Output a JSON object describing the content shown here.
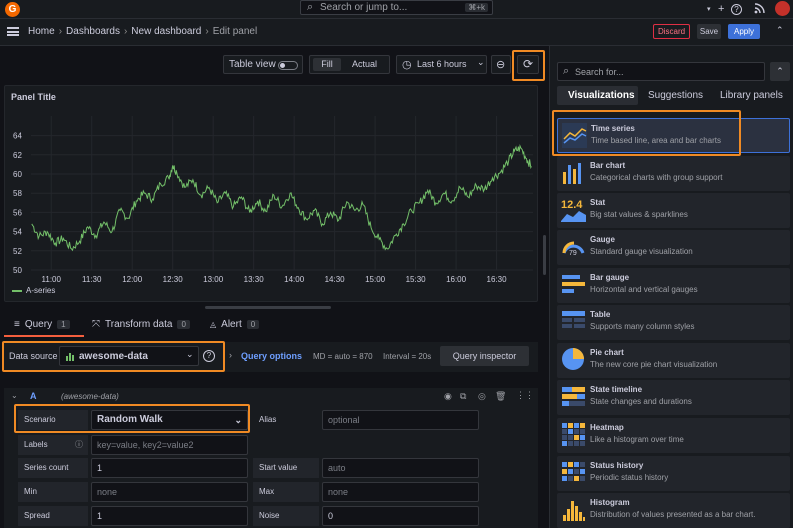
{
  "topbar": {
    "search_placeholder": "Search or jump to...",
    "search_shortcut": "⌘+k",
    "plus": "+",
    "plus_caret": "▾",
    "help": "?",
    "news": "☰",
    "logo": "G"
  },
  "breadcrumb": {
    "home": "Home",
    "dashboards": "Dashboards",
    "new_dashboard": "New dashboard",
    "current": "Edit panel",
    "separator": "›"
  },
  "actions": {
    "discard": "Discard",
    "save": "Save",
    "apply": "Apply",
    "collapse": "⌃"
  },
  "toolbar": {
    "table_view": "Table view",
    "fill": "Fill",
    "actual": "Actual",
    "time_range": "Last 6 hours",
    "time_caret": "⌄",
    "zoom_out": "⊖",
    "refresh": "⟳",
    "clock": "◷"
  },
  "panel": {
    "title": "Panel Title",
    "legend_series": "A-series"
  },
  "chart_data": {
    "type": "line",
    "title": "Panel Title",
    "xlabel": "",
    "ylabel": "",
    "ylim": [
      50,
      65
    ],
    "y_ticks": [
      "50",
      "52",
      "54",
      "56",
      "58",
      "60",
      "62",
      "64"
    ],
    "x_ticks": [
      "11:00",
      "11:30",
      "12:00",
      "12:30",
      "13:00",
      "13:30",
      "14:00",
      "14:30",
      "15:00",
      "15:30",
      "16:00",
      "16:30"
    ],
    "x_range_hours": [
      10.75,
      16.95
    ],
    "series": [
      {
        "name": "A-series",
        "color": "#73bf69",
        "points": [
          [
            10.76,
            54.8
          ],
          [
            10.85,
            53.5
          ],
          [
            10.95,
            54.0
          ],
          [
            11.05,
            52.8
          ],
          [
            11.15,
            53.3
          ],
          [
            11.25,
            52.2
          ],
          [
            11.35,
            53.0
          ],
          [
            11.45,
            54.5
          ],
          [
            11.55,
            53.6
          ],
          [
            11.65,
            55.0
          ],
          [
            11.75,
            54.0
          ],
          [
            11.85,
            56.2
          ],
          [
            11.95,
            55.4
          ],
          [
            12.05,
            57.2
          ],
          [
            12.15,
            58.0
          ],
          [
            12.25,
            57.4
          ],
          [
            12.35,
            59.0
          ],
          [
            12.45,
            59.6
          ],
          [
            12.5,
            60.9
          ],
          [
            12.55,
            60.2
          ],
          [
            12.65,
            58.6
          ],
          [
            12.75,
            59.4
          ],
          [
            12.85,
            57.8
          ],
          [
            12.95,
            58.6
          ],
          [
            13.05,
            57.0
          ],
          [
            13.15,
            58.0
          ],
          [
            13.25,
            56.6
          ],
          [
            13.35,
            57.6
          ],
          [
            13.45,
            56.0
          ],
          [
            13.55,
            57.2
          ],
          [
            13.65,
            56.1
          ],
          [
            13.75,
            57.8
          ],
          [
            13.85,
            56.6
          ],
          [
            13.95,
            58.0
          ],
          [
            14.05,
            56.5
          ],
          [
            14.15,
            55.3
          ],
          [
            14.25,
            56.2
          ],
          [
            14.35,
            54.8
          ],
          [
            14.45,
            56.0
          ],
          [
            14.55,
            55.2
          ],
          [
            14.65,
            57.1
          ],
          [
            14.75,
            56.2
          ],
          [
            14.85,
            56.8
          ],
          [
            14.95,
            54.4
          ],
          [
            15.05,
            53.2
          ],
          [
            15.15,
            52.2
          ],
          [
            15.25,
            53.6
          ],
          [
            15.35,
            54.8
          ],
          [
            15.45,
            56.2
          ],
          [
            15.55,
            57.0
          ],
          [
            15.65,
            58.3
          ],
          [
            15.75,
            57.0
          ],
          [
            15.85,
            58.0
          ],
          [
            15.95,
            57.2
          ],
          [
            16.05,
            58.6
          ],
          [
            16.15,
            57.6
          ],
          [
            16.25,
            58.8
          ],
          [
            16.35,
            58.4
          ],
          [
            16.45,
            59.6
          ],
          [
            16.55,
            60.2
          ],
          [
            16.65,
            61.4
          ],
          [
            16.72,
            62.4
          ],
          [
            16.8,
            62.7
          ],
          [
            16.87,
            61.6
          ],
          [
            16.93,
            60.8
          ]
        ]
      }
    ],
    "grid": true,
    "legend": "bottom-left"
  },
  "query_tabs": [
    {
      "label": "Query",
      "count": "1",
      "icon": "≡"
    },
    {
      "label": "Transform data",
      "count": "0",
      "icon": "⤧"
    },
    {
      "label": "Alert",
      "count": "0",
      "icon": "🔔"
    }
  ],
  "datasource": {
    "label": "Data source",
    "value": "awesome-data",
    "caret": "⌄",
    "help": "?"
  },
  "query_options": {
    "label": "Query options",
    "md": "MD = auto = 870",
    "interval": "Interval = 20s",
    "inspector": "Query inspector"
  },
  "query": {
    "ref": "A",
    "source_hint": "(awesome-data)",
    "scenario_label": "Scenario",
    "scenario_value": "Random Walk",
    "alias_label": "Alias",
    "alias_placeholder": "optional",
    "labels_label": "Labels",
    "labels_placeholder": "key=value, key2=value2",
    "series_count_label": "Series count",
    "series_count_value": "1",
    "start_value_label": "Start value",
    "start_value_placeholder": "auto",
    "min_label": "Min",
    "min_placeholder": "none",
    "max_label": "Max",
    "max_placeholder": "none",
    "spread_label": "Spread",
    "spread_value": "1",
    "noise_label": "Noise",
    "noise_value": "0"
  },
  "viz_panel": {
    "search_placeholder": "Search for...",
    "tabs": [
      "Visualizations",
      "Suggestions",
      "Library panels"
    ],
    "items": [
      {
        "name": "Time series",
        "desc": "Time based line, area and bar charts"
      },
      {
        "name": "Bar chart",
        "desc": "Categorical charts with group support"
      },
      {
        "name": "Stat",
        "desc": "Big stat values & sparklines"
      },
      {
        "name": "Gauge",
        "desc": "Standard gauge visualization"
      },
      {
        "name": "Bar gauge",
        "desc": "Horizontal and vertical gauges"
      },
      {
        "name": "Table",
        "desc": "Supports many column styles"
      },
      {
        "name": "Pie chart",
        "desc": "The new core pie chart visualization"
      },
      {
        "name": "State timeline",
        "desc": "State changes and durations"
      },
      {
        "name": "Heatmap",
        "desc": "Like a histogram over time"
      },
      {
        "name": "Status history",
        "desc": "Periodic status history"
      },
      {
        "name": "Histogram",
        "desc": "Distribution of values presented as a bar chart."
      }
    ],
    "stat_icon_text": "12.4",
    "gauge_icon_text": "79"
  },
  "colors": {
    "accent": "#f08a24",
    "series": "#73bf69",
    "primary": "#3d71d9",
    "danger": "#e02f44"
  }
}
